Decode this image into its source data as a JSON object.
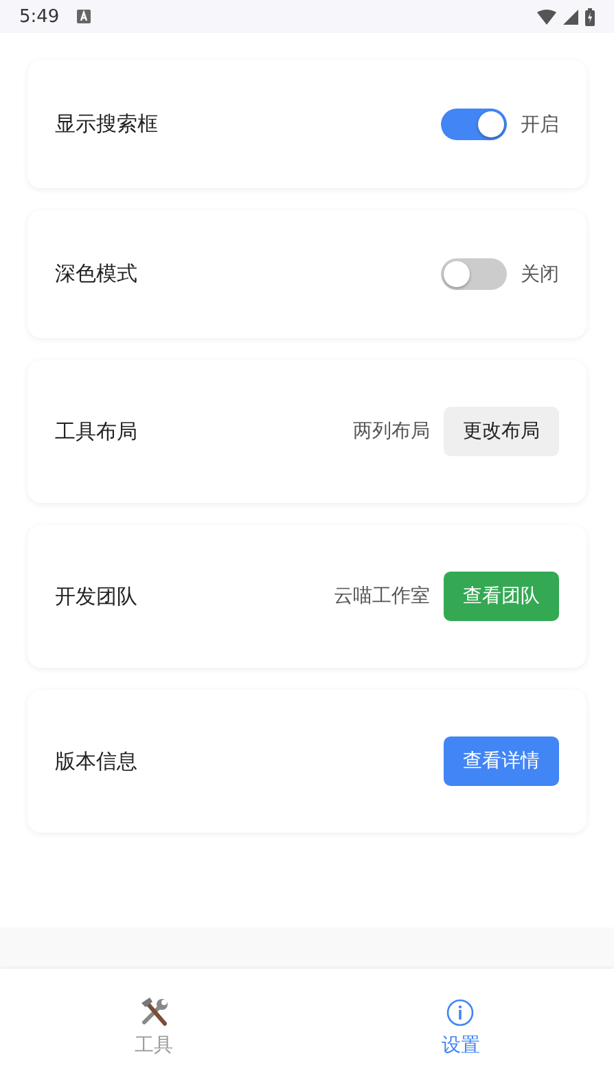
{
  "status_bar": {
    "time": "5:49"
  },
  "settings": [
    {
      "kind": "toggle",
      "label": "显示搜索框",
      "on": true,
      "state_text": "开启"
    },
    {
      "kind": "toggle",
      "label": "深色模式",
      "on": false,
      "state_text": "关闭"
    },
    {
      "kind": "button",
      "label": "工具布局",
      "value": "两列布局",
      "button": "更改布局",
      "color": "#efefef"
    },
    {
      "kind": "button",
      "label": "开发团队",
      "value": "云喵工作室",
      "button": "查看团队",
      "color": "#34a853"
    },
    {
      "kind": "button",
      "label": "版本信息",
      "button": "查看详情",
      "color": "#4285f4"
    }
  ],
  "nav": [
    {
      "kind": "tools",
      "label": "工具",
      "selected": false
    },
    {
      "kind": "info",
      "label": "设置",
      "selected": true
    }
  ]
}
